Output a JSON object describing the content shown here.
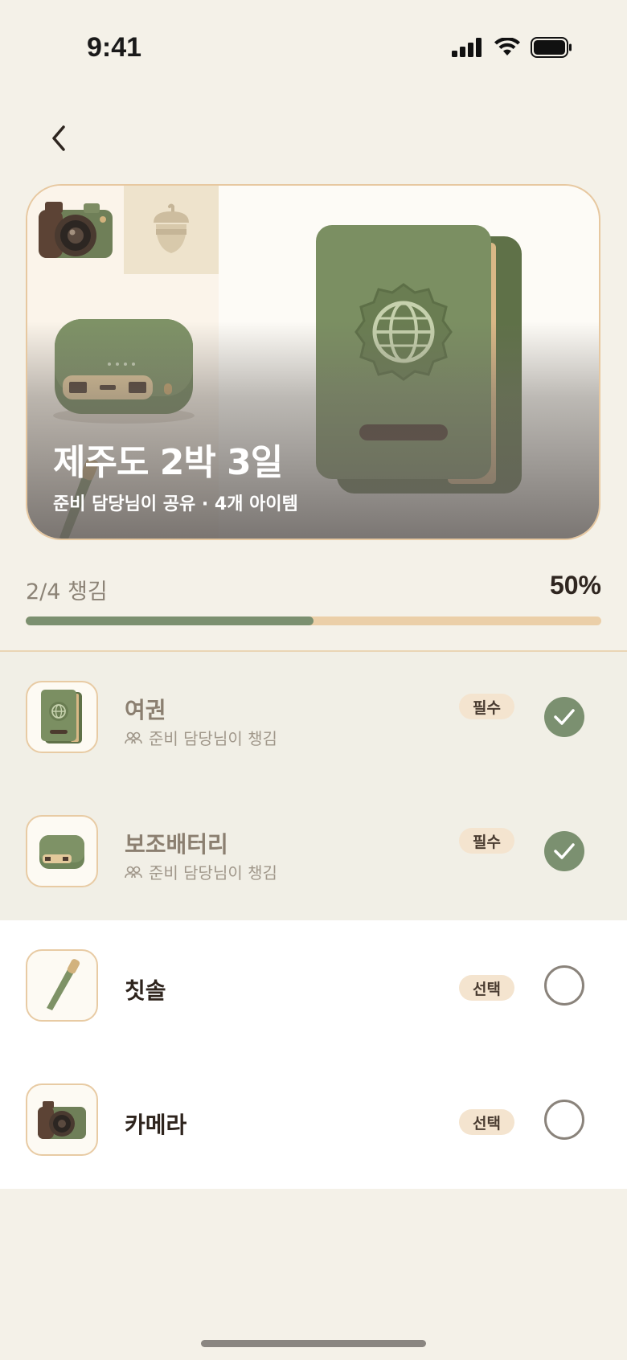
{
  "status_bar": {
    "time": "9:41"
  },
  "hero": {
    "title": "제주도 2박 3일",
    "subtitle": "준비 담당님이 공유 · 4개 아이템"
  },
  "progress": {
    "label": "2/4 챙김",
    "percent_label": "50%",
    "fraction": 0.5
  },
  "items": [
    {
      "name": "여권",
      "sub": "준비 담당님이 챙김",
      "badge": "필수",
      "checked": true,
      "icon": "passport-icon"
    },
    {
      "name": "보조배터리",
      "sub": "준비 담당님이 챙김",
      "badge": "필수",
      "checked": true,
      "icon": "power-bank-icon"
    },
    {
      "name": "칫솔",
      "sub": "",
      "badge": "선택",
      "checked": false,
      "icon": "toothbrush-icon"
    },
    {
      "name": "카메라",
      "sub": "",
      "badge": "선택",
      "checked": false,
      "icon": "camera-icon"
    }
  ],
  "colors": {
    "accent": "#7b9070",
    "track": "#ebcfa8",
    "background": "#f4f1e8",
    "badge": "#f4e4cf"
  }
}
